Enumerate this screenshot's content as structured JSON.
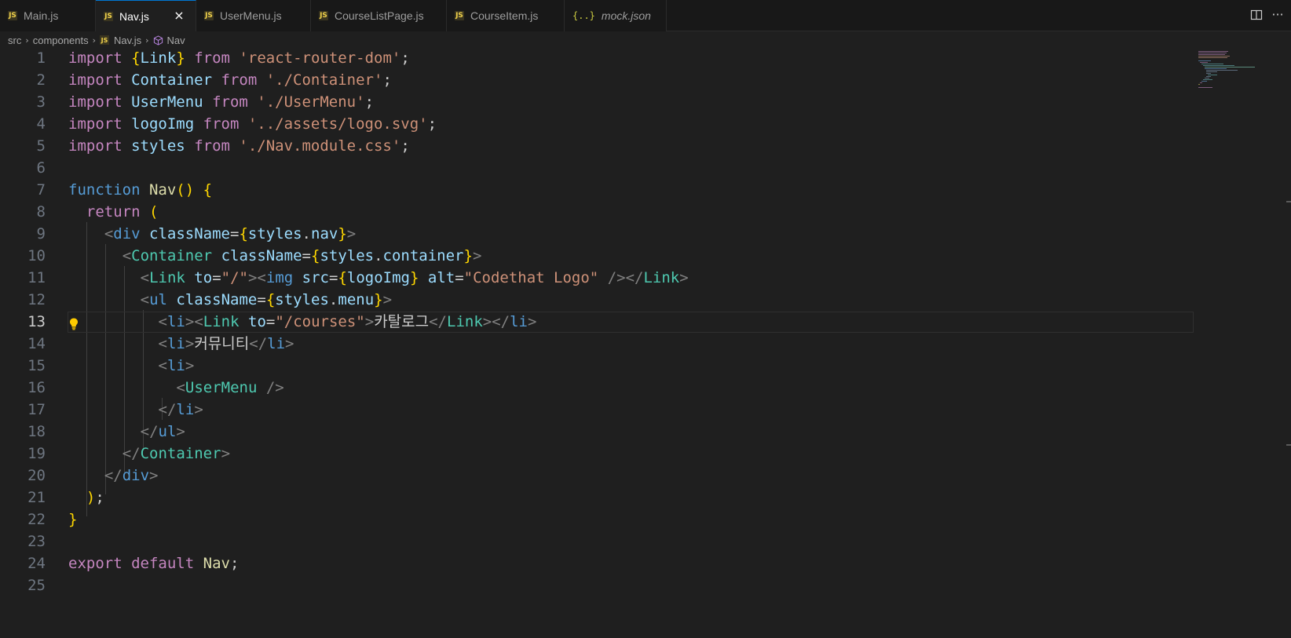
{
  "tabs": [
    {
      "label": "Main.js",
      "icon": "js-file-icon",
      "active": false
    },
    {
      "label": "Nav.js",
      "icon": "js-file-icon",
      "active": true
    },
    {
      "label": "UserMenu.js",
      "icon": "js-file-icon",
      "active": false
    },
    {
      "label": "CourseListPage.js",
      "icon": "js-file-icon",
      "active": false
    },
    {
      "label": "CourseItem.js",
      "icon": "js-file-icon",
      "active": false
    },
    {
      "label": "mock.json",
      "icon": "json-file-icon",
      "active": false
    }
  ],
  "tab_icons": {
    "js": "JS",
    "json": "{..}",
    "close": "×",
    "more": "···"
  },
  "breadcrumb": {
    "items": [
      "src",
      "components",
      "Nav.js",
      "Nav"
    ],
    "separator": "›"
  },
  "editor": {
    "active_line": 13,
    "line_numbers": [
      "1",
      "2",
      "3",
      "4",
      "5",
      "6",
      "7",
      "8",
      "9",
      "10",
      "11",
      "12",
      "13",
      "14",
      "15",
      "16",
      "17",
      "18",
      "19",
      "20",
      "21",
      "22",
      "23",
      "24",
      "25"
    ],
    "lines": [
      "import {Link} from 'react-router-dom';",
      "import Container from './Container';",
      "import UserMenu from './UserMenu';",
      "import logoImg from '../assets/logo.svg';",
      "import styles from './Nav.module.css';",
      "",
      "function Nav() {",
      "  return (",
      "    <div className={styles.nav}>",
      "      <Container className={styles.container}>",
      "        <Link to=\"/\"><img src={logoImg} alt=\"Codethat Logo\" /></Link>",
      "        <ul className={styles.menu}>",
      "          <li><Link to=\"/courses\">카탈로그</Link></li>",
      "          <li>커뮤니티</li>",
      "          <li>",
      "            <UserMenu />",
      "          </li>",
      "        </ul>",
      "      </Container>",
      "    </div>",
      "  );",
      "}",
      "",
      "export default Nav;",
      ""
    ]
  },
  "colors": {
    "background": "#1f1f1f",
    "tabbar": "#181818",
    "keyword": "#c586c0",
    "string": "#ce9178",
    "variable": "#9cdcfe",
    "component": "#4ec9b0",
    "tag": "#569cd6"
  }
}
